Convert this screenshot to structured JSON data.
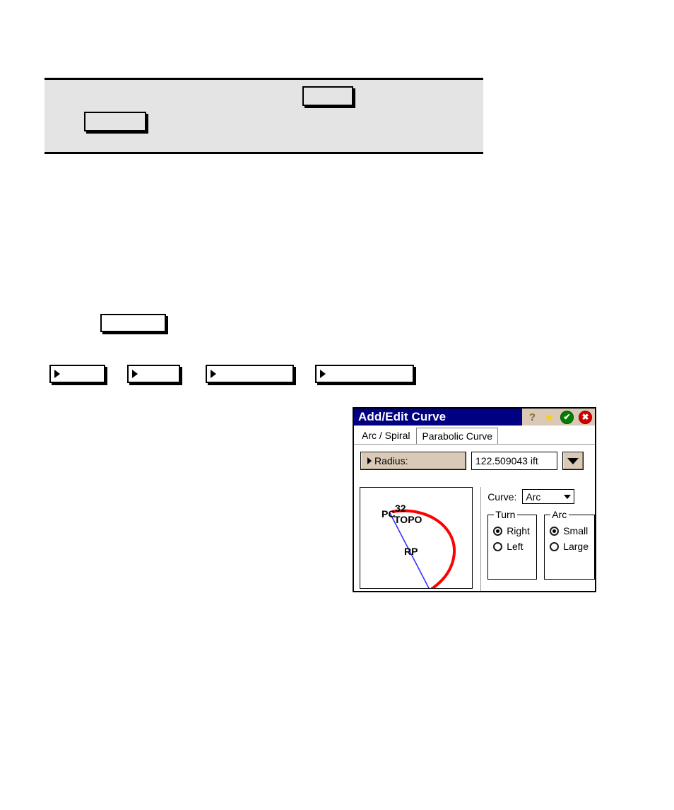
{
  "document": {
    "top_panel": {
      "box_a_label": "",
      "box_b_label": ""
    },
    "standalone_box_label": "",
    "arrow_buttons": [
      {
        "label": "",
        "icon": "triangle-right-icon"
      },
      {
        "label": "",
        "icon": "triangle-right-icon"
      },
      {
        "label": "",
        "icon": "triangle-right-icon"
      },
      {
        "label": "",
        "icon": "triangle-right-icon"
      }
    ]
  },
  "dialog": {
    "title": "Add/Edit Curve",
    "title_icons": [
      {
        "name": "help-icon",
        "glyph": "?"
      },
      {
        "name": "star-icon",
        "glyph": "★"
      },
      {
        "name": "ok-icon",
        "glyph": "✔"
      },
      {
        "name": "close-icon",
        "glyph": "✖"
      }
    ],
    "colors": {
      "titlebar": "#000080",
      "titlebar_text": "#ffffff",
      "button_face": "#d9c9b6",
      "arc_curve": "#ff0000",
      "chord_line": "#3333ff",
      "ok_green": "#008000",
      "close_red": "#d00000"
    },
    "tabs": [
      {
        "label": "Arc / Spiral",
        "active": true
      },
      {
        "label": "Parabolic Curve",
        "active": false
      }
    ],
    "radius": {
      "button_label": "Radius:",
      "value": "122.509043 ift",
      "dropdown_icon": "chevron-down-icon"
    },
    "preview": {
      "labels": {
        "pc": "PC",
        "point_number": "32",
        "topo": "TOPO",
        "rp": "RP"
      }
    },
    "curve": {
      "label": "Curve:",
      "selected": "Arc",
      "options": [
        "Arc"
      ]
    },
    "turn": {
      "legend": "Turn",
      "options": [
        {
          "label": "Right",
          "selected": true
        },
        {
          "label": "Left",
          "selected": false
        }
      ]
    },
    "arc": {
      "legend": "Arc",
      "options": [
        {
          "label": "Small",
          "selected": true
        },
        {
          "label": "Large",
          "selected": false
        }
      ]
    }
  }
}
